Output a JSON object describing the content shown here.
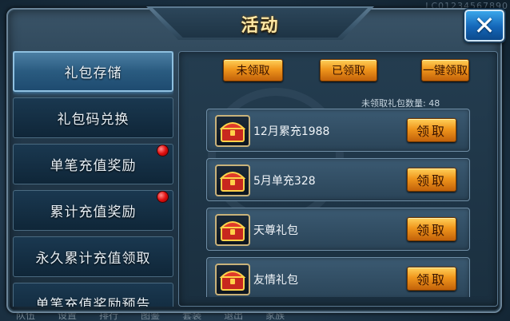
{
  "title": "活动",
  "background_text": "LC01234567890",
  "bottom_bar": [
    "队伍",
    "设置",
    "排行",
    "图鉴",
    "套装",
    "退出",
    "家族"
  ],
  "tabs": [
    {
      "label": "礼包存储",
      "active": true,
      "red_dot": false
    },
    {
      "label": "礼包码兑换",
      "active": false,
      "red_dot": false
    },
    {
      "label": "单笔充值奖励",
      "active": false,
      "red_dot": true
    },
    {
      "label": "累计充值奖励",
      "active": false,
      "red_dot": true
    },
    {
      "label": "永久累计充值领取",
      "active": false,
      "red_dot": false
    },
    {
      "label": "单笔充值奖励预告",
      "active": false,
      "red_dot": false
    }
  ],
  "filters": {
    "unclaimed": "未领取",
    "claimed": "已领取",
    "claim_all": "一键领取"
  },
  "count": {
    "label": "未领取礼包数量:",
    "value": "48"
  },
  "gifts": [
    {
      "name": "12月累充1988",
      "button": "领取"
    },
    {
      "name": "5月单充328",
      "button": "领取"
    },
    {
      "name": "天尊礼包",
      "button": "领取"
    },
    {
      "name": "友情礼包",
      "button": "领取"
    }
  ],
  "icons": {
    "close": "close-icon",
    "chest": "treasure-chest-icon",
    "notification": "red-dot-icon"
  },
  "colors": {
    "accent_gold": "#f0961c",
    "title": "#ffe9a6",
    "active_tab": "#2a5b80",
    "notification": "#e01010"
  }
}
